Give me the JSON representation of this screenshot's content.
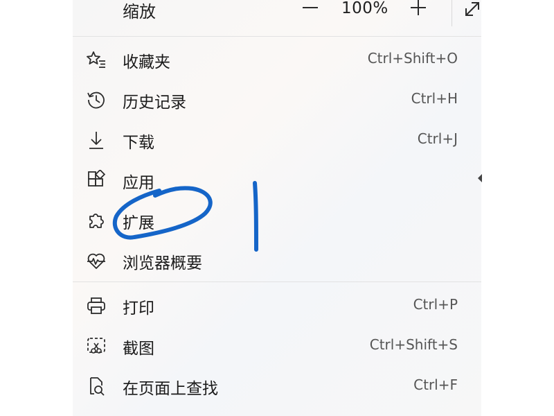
{
  "zoom": {
    "label": "缩放",
    "minus": "—",
    "value": "100%",
    "plus": "+"
  },
  "menu_groups": [
    [
      {
        "name": "favorites",
        "icon": "star-list-icon",
        "label": "收藏夹",
        "shortcut": "Ctrl+Shift+O"
      },
      {
        "name": "history",
        "icon": "history-icon",
        "label": "历史记录",
        "shortcut": "Ctrl+H"
      },
      {
        "name": "downloads",
        "icon": "download-icon",
        "label": "下载",
        "shortcut": "Ctrl+J"
      },
      {
        "name": "apps",
        "icon": "apps-icon",
        "label": "应用",
        "shortcut": ""
      },
      {
        "name": "extensions",
        "icon": "puzzle-icon",
        "label": "扩展",
        "shortcut": ""
      },
      {
        "name": "browser-essentials",
        "icon": "heartbeat-icon",
        "label": "浏览器概要",
        "shortcut": ""
      }
    ],
    [
      {
        "name": "print",
        "icon": "printer-icon",
        "label": "打印",
        "shortcut": "Ctrl+P"
      },
      {
        "name": "screenshot",
        "icon": "screenshot-icon",
        "label": "截图",
        "shortcut": "Ctrl+Shift+S"
      },
      {
        "name": "find-on-page",
        "icon": "find-page-icon",
        "label": "在页面上查找",
        "shortcut": "Ctrl+F"
      }
    ]
  ],
  "colors": {
    "annotation": "#1565c8",
    "icon": "#2b2b2b",
    "shortcut": "#555555"
  }
}
